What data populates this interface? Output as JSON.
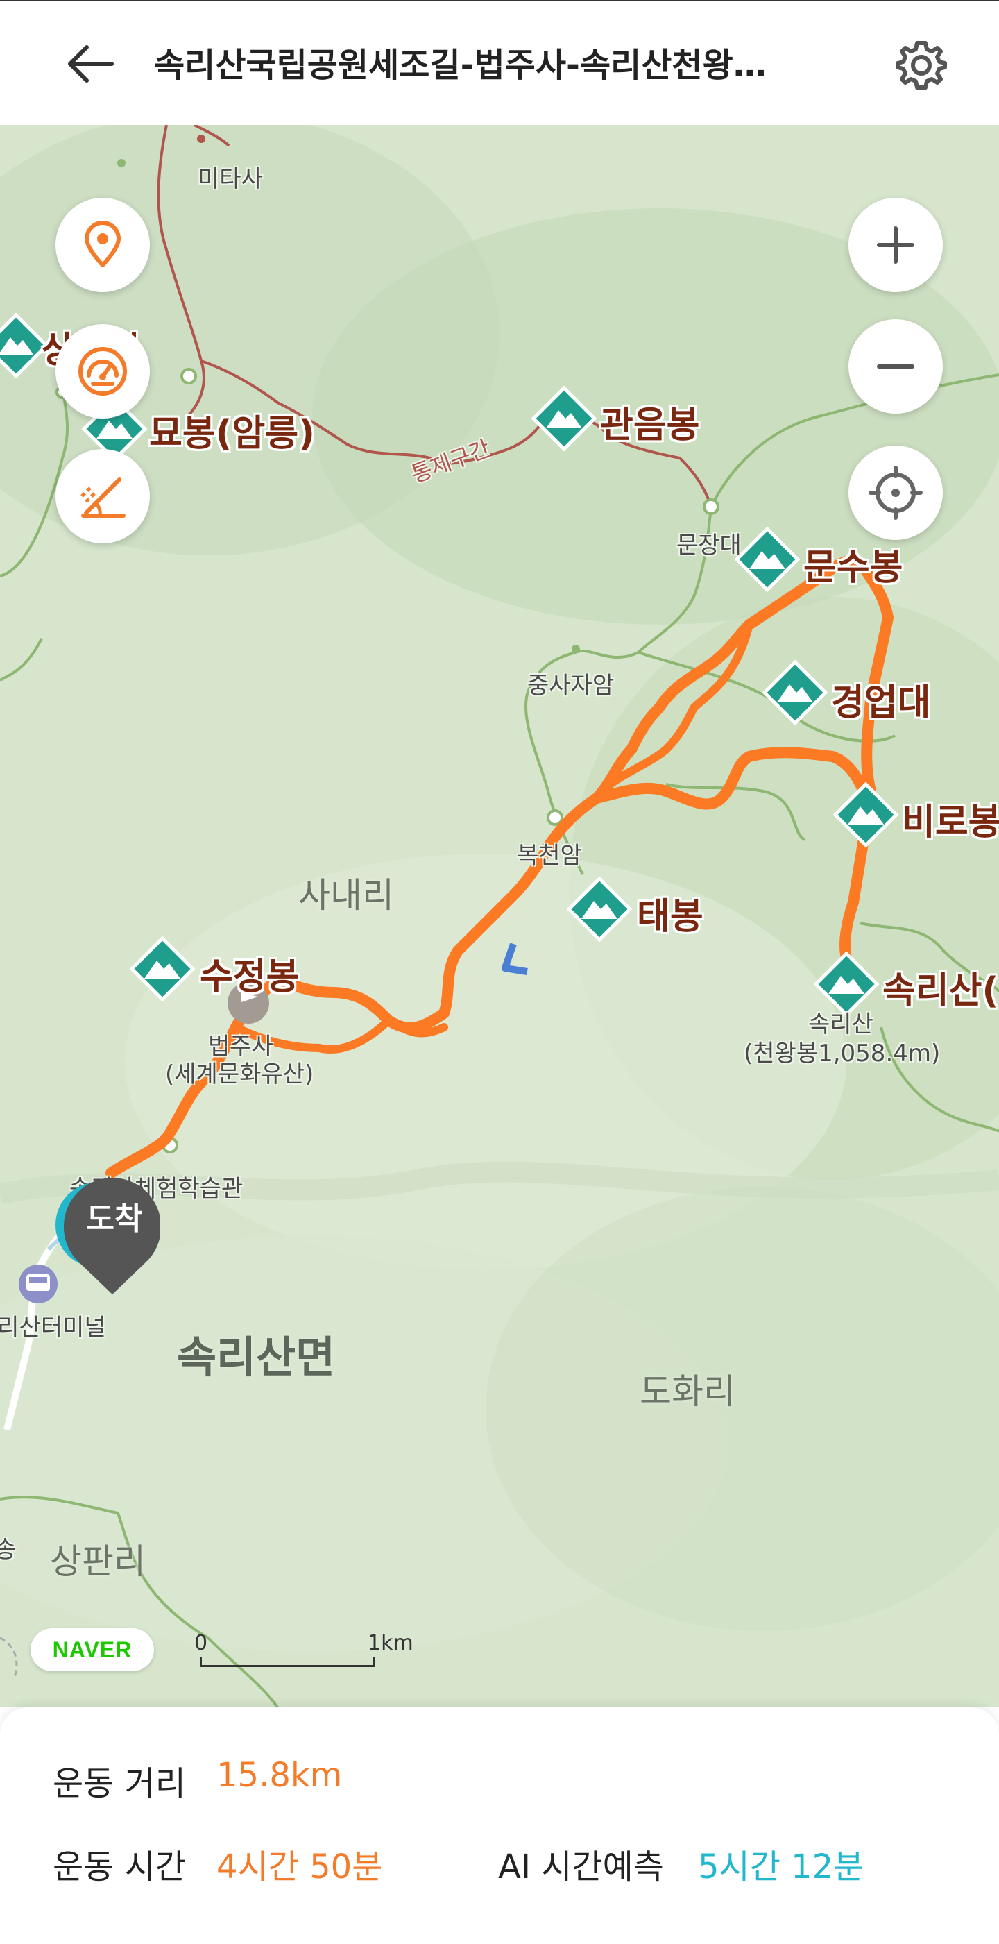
{
  "header": {
    "title": "속리산국립공원세조길-법주사-속리산천왕…"
  },
  "map": {
    "peaks": [
      {
        "label": "상학봉",
        "visible": "상학봉"
      },
      {
        "label": "묘봉(암릉)"
      },
      {
        "label": "관음봉"
      },
      {
        "label": "문수봉"
      },
      {
        "label": "경업대"
      },
      {
        "label": "비로봉"
      },
      {
        "label": "태봉"
      },
      {
        "label": "수정봉"
      },
      {
        "label": "속리산("
      }
    ],
    "areas": {
      "sanaeri": "사내리",
      "songnisanmyeon": "속리산면",
      "dohwari": "도화리",
      "sangpanri": "상판리"
    },
    "pois": {
      "mitasa": "미타사",
      "munjangdae": "문장대",
      "jungsajaam": "중사자암",
      "bokcheonam": "복천암",
      "beopjusa": "법주사",
      "beopjusa_sub": "(세계문화유산)",
      "experience_hall": "속리산체험학습관",
      "terminal": "속리산터미널",
      "songnisan": "속리산",
      "cheonwangbong": "(천왕봉1,058.4m)",
      "restricted": "통제구간",
      "left_edge": "송"
    },
    "arrival_label": "도착",
    "naver": "NAVER",
    "scale": {
      "start": "0",
      "end": "1km"
    }
  },
  "stats": {
    "distance_label": "운동 거리",
    "distance_value": "15.8km",
    "time_label": "운동 시간",
    "time_value": "4시간 50분",
    "ai_label": "AI 시간예측",
    "ai_value": "5시간 12분"
  },
  "colors": {
    "route": "#fb7a23",
    "peak_marker": "#1f9e8e",
    "accent_teal": "#22b7cc",
    "accent_orange": "#f47b2a",
    "trail_red": "#b0564c"
  }
}
